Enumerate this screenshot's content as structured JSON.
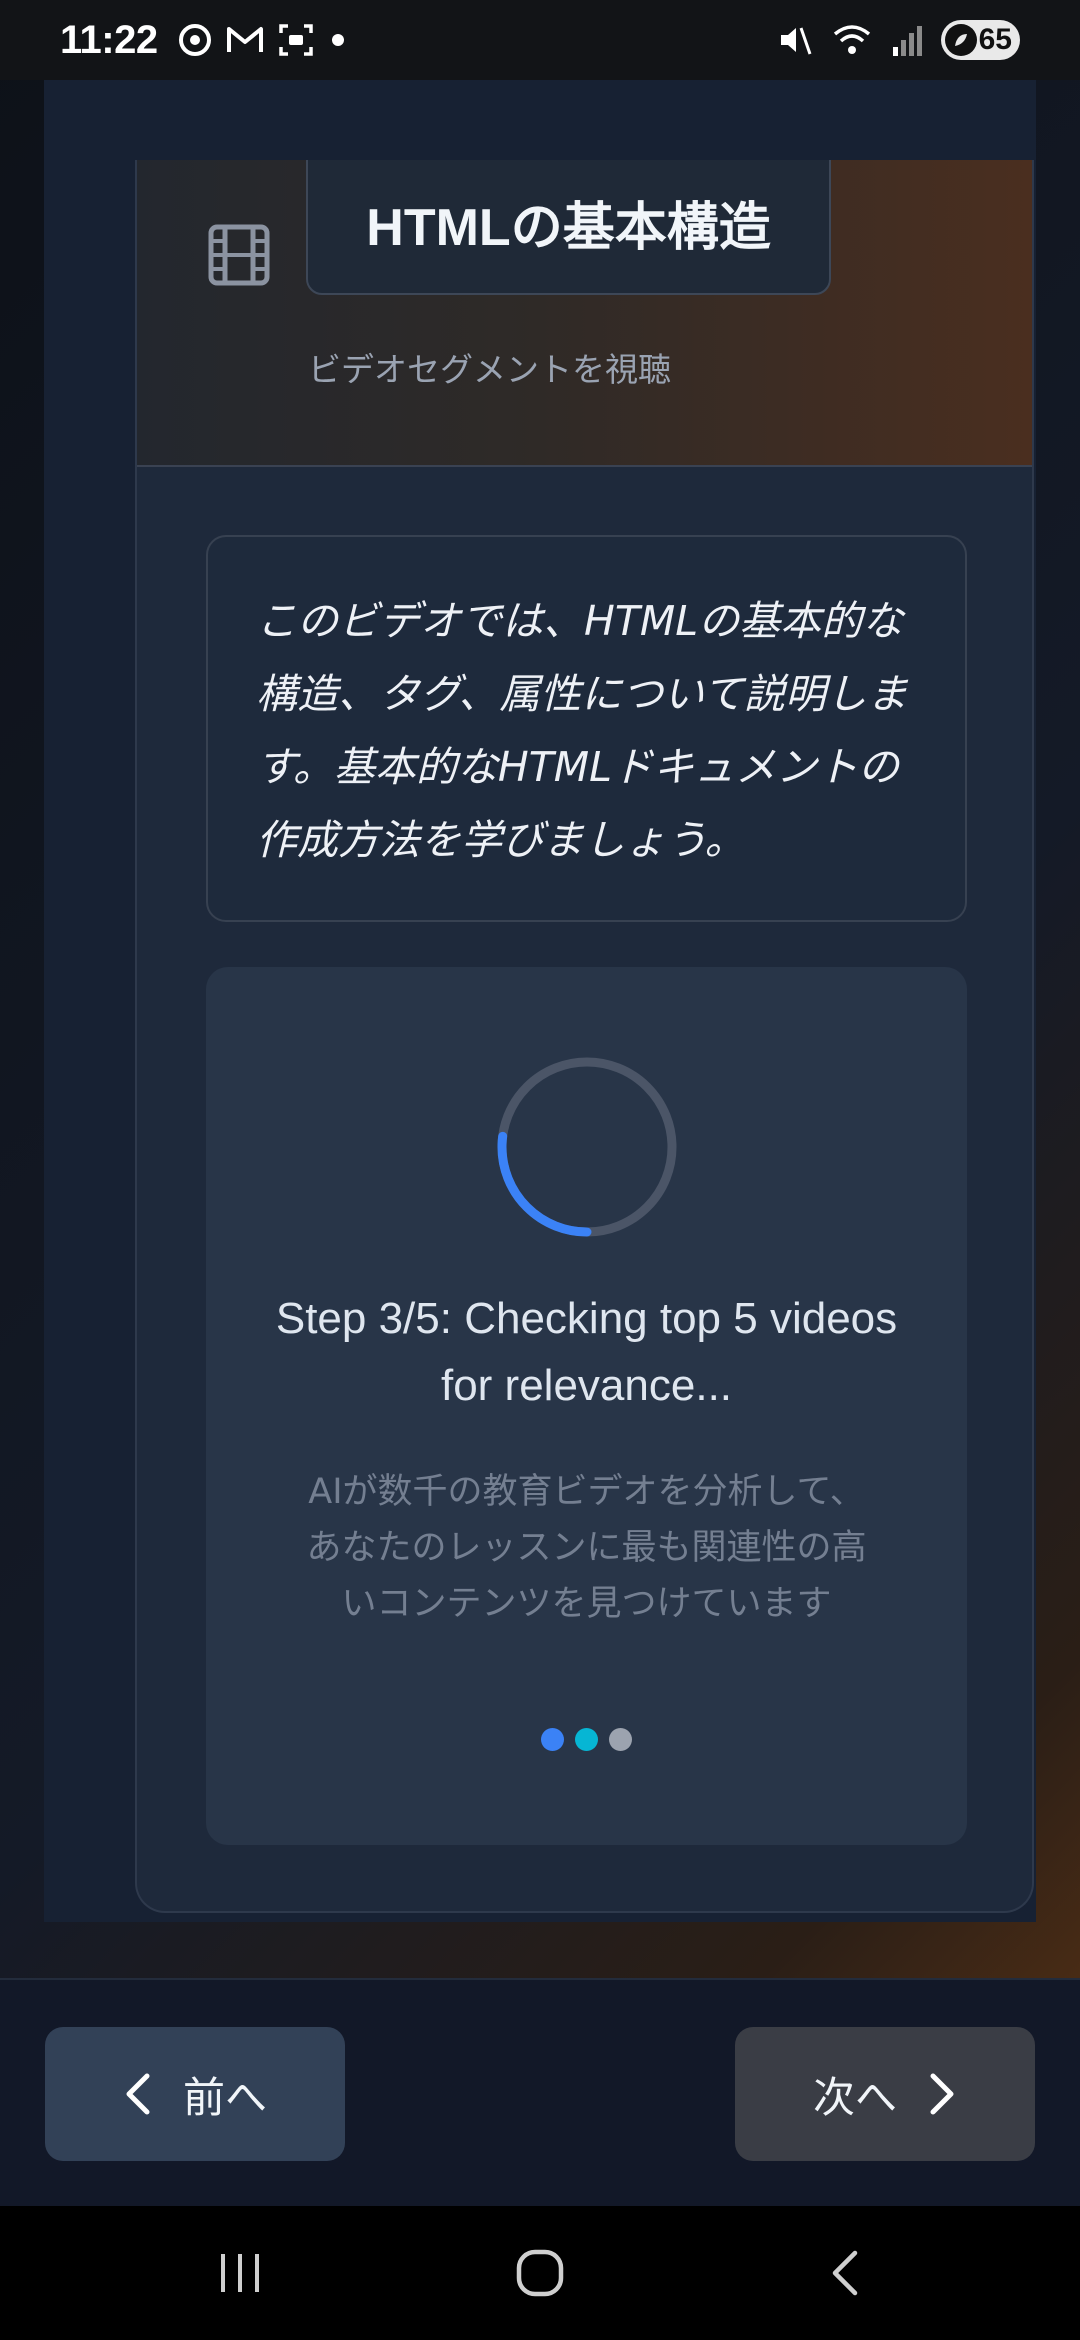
{
  "status_bar": {
    "time": "11:22",
    "battery": "65"
  },
  "lesson": {
    "title": "HTMLの基本構造",
    "subtitle": "ビデオセグメントを視聴",
    "description": "このビデオでは、HTMLの基本的な構造、タグ、属性について説明します。基本的なHTMLドキュメントの作成方法を学びましょう。"
  },
  "loading": {
    "step_text": "Step 3/5: Checking top 5 videos for relevance...",
    "ai_text": "AIが数千の教育ビデオを分析して、あなたのレッスンに最も関連性の高いコンテンツを見つけています",
    "progress": 0.27
  },
  "nav": {
    "prev_label": "前へ",
    "next_label": "次へ"
  },
  "colors": {
    "accent": "#3b82f6",
    "dot_1": "#3b82f6",
    "dot_2": "#06b6d4",
    "dot_3": "#9ca3af"
  }
}
